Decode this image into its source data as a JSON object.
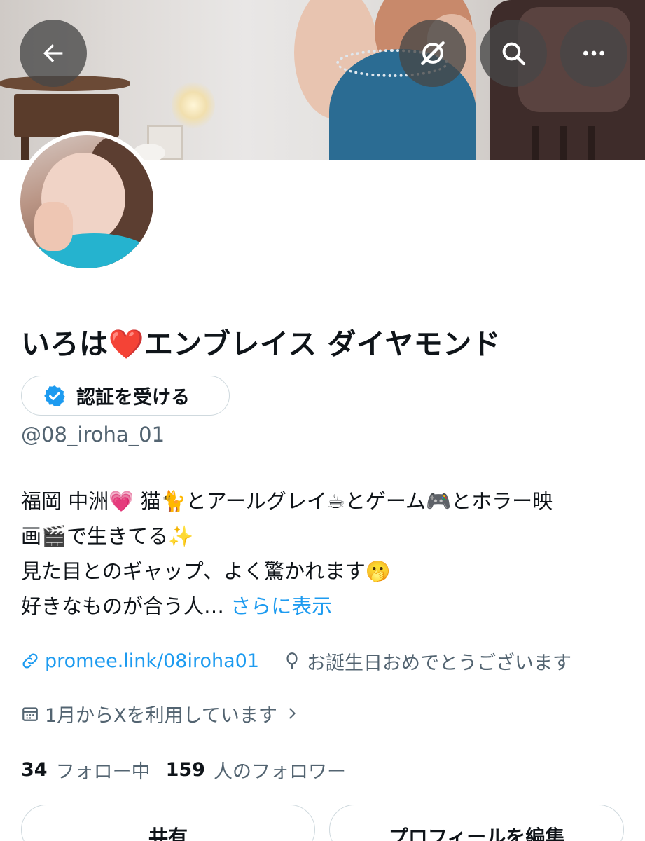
{
  "header": {
    "back_icon": "arrow-left-icon",
    "grok_icon": "grok-icon",
    "search_icon": "search-icon",
    "more_icon": "more-dots-icon"
  },
  "profile": {
    "display_name": "いろは❤️エンブレイス ダイヤモンド",
    "verify_label": "認証を受ける",
    "handle": "@08_iroha_01",
    "bio_lines": [
      "福岡 中洲💗 猫🐈とアールグレイ☕とゲーム🎮とホラー映",
      "画🎬で生きてる✨",
      "見た目とのギャップ、よく驚かれます🫢"
    ],
    "bio_last": "好きなものが合う人… ",
    "bio_more": "さらに表示",
    "link": "promee.link/08iroha01",
    "birthday": "お誕生日おめでとうございます",
    "joined": "1月からXを利用しています",
    "following_count": "34",
    "following_label": "フォロー中",
    "followers_count": "159",
    "followers_label": "人のフォロワー",
    "share_label": "共有",
    "edit_label": "プロフィールを編集"
  },
  "colors": {
    "accent": "#1d9bf0",
    "secondary_text": "#536471",
    "border": "#cfd9de"
  }
}
